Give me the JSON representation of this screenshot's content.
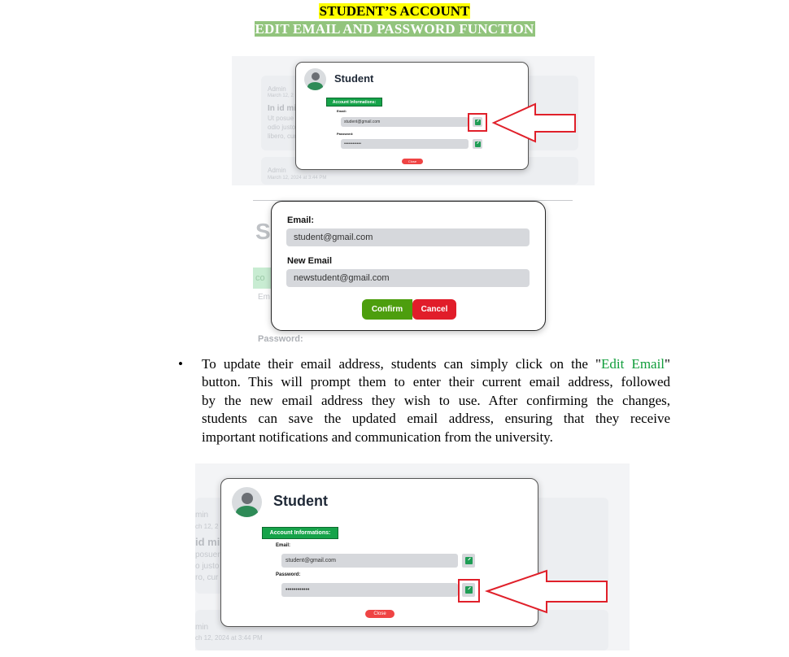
{
  "headings": {
    "title": "STUDENT’S ACCOUNT",
    "subtitle": "EDIT EMAIL AND PASSWORD FUNCTION"
  },
  "shot1": {
    "bg_admin": "Admin",
    "bg_date": "March 12, 2",
    "bg_heading": "In id mi",
    "bg_text1": "Ut posue",
    "bg_text2": "odio justo",
    "bg_text3": "libero, cur",
    "bg_admin2": "Admin",
    "bg_date2": "March 12, 2024 at 3:44 PM",
    "student": "Student",
    "badge": "Account Informations:",
    "email_label": "Email:",
    "email_value": "student@gmail.com",
    "password_label": "Password:",
    "password_value": "••••••••••••",
    "close": "Close"
  },
  "shot2": {
    "bg_letter": "St",
    "bg_co": "co",
    "bg_em": "Em",
    "bg_password": "Password:",
    "email_label": "Email:",
    "email_value": "student@gmail.com",
    "new_email_label": "New Email",
    "new_email_value": "newstudent@gmail.com",
    "confirm": "Confirm",
    "cancel": "Cancel"
  },
  "bullet": {
    "l1_pre": "To update their email address, students can simply click on the \"",
    "l1_link": "Edit Email",
    "l1_post": "\"",
    "l2": "button. This will prompt them to enter their current email address, followed",
    "l3": "by the new email address they wish to use. After confirming the changes,",
    "l4": "students can save the updated email address, ensuring that they receive",
    "l5": "important notifications and communication from the university."
  },
  "shot3": {
    "bg_admin": "min",
    "bg_date": "ch 12, 2",
    "bg_heading": "id mi",
    "bg_text1": "posuer",
    "bg_text2": "o justo",
    "bg_text3": "ro, cur",
    "bg_admin2": "min",
    "bg_date2": "ch 12, 2024 at 3:44 PM",
    "student": "Student",
    "badge": "Account Informations:",
    "email_label": "Email:",
    "email_value": "student@gmail.com",
    "password_label": "Password:",
    "password_value": "••••••••••••",
    "close": "Close"
  },
  "colors": {
    "highlight_yellow": "#ffff00",
    "highlight_green": "#92c47d",
    "accent_green": "#16a34a",
    "confirm_green": "#4d9e0e",
    "cancel_red": "#e11d2a",
    "arrow_red": "#e0202a"
  }
}
